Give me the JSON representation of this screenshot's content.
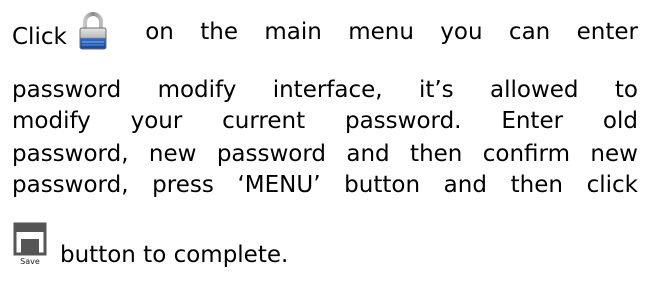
{
  "document": {
    "line1": {
      "prefix": "Click",
      "icon": "lock-icon",
      "words": [
        "on",
        "the",
        "main",
        "menu",
        "you",
        "can",
        "enter"
      ]
    },
    "line2": {
      "words": [
        "password",
        "modify",
        "interface,",
        "it’s",
        "allowed",
        "to"
      ]
    },
    "line3": {
      "words": [
        "modify",
        "your",
        "current",
        "password.",
        "Enter",
        "old"
      ]
    },
    "line4": {
      "words": [
        "password,",
        "new",
        "password",
        "and",
        "then",
        "confirm",
        "new"
      ]
    },
    "line5": {
      "words": [
        "password,",
        "press",
        "‘MENU’",
        "button",
        "and",
        "then",
        "click"
      ]
    },
    "line6": {
      "icon": "save-icon",
      "icon_caption": "Save",
      "text": "button to complete."
    }
  },
  "colors": {
    "text": "#000000",
    "lock_body": "#1f5fb4",
    "lock_shackle": "#9a9a9a",
    "save_frame": "#555555"
  }
}
